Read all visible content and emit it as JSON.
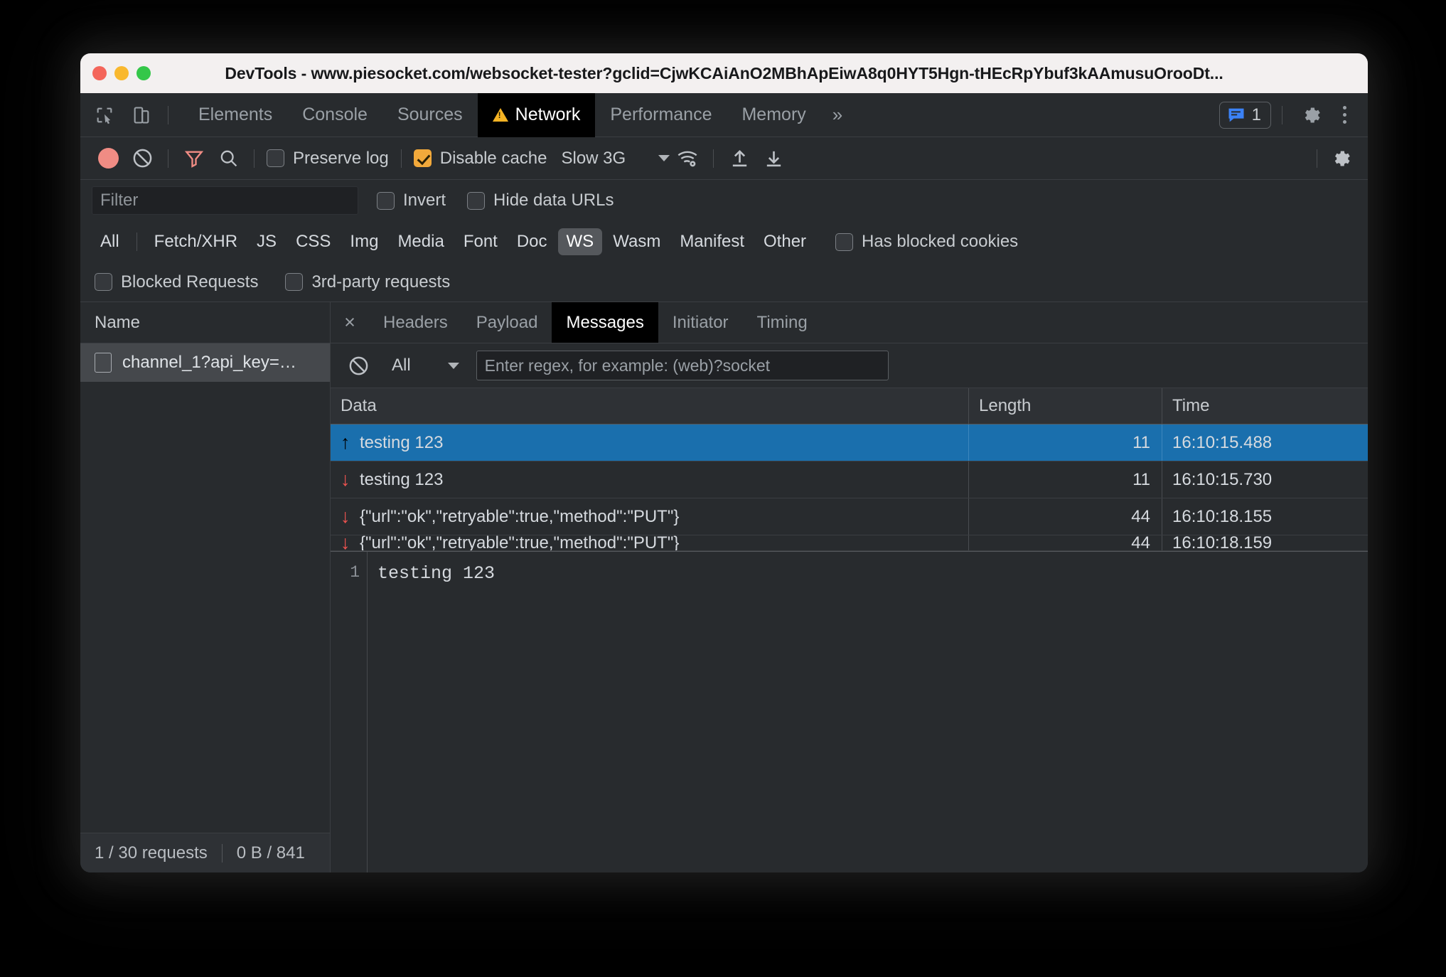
{
  "window": {
    "title": "DevTools - www.piesocket.com/websocket-tester?gclid=CjwKCAiAnO2MBhApEiwA8q0HYT5Hgn-tHEcRpYbuf3kAAmusuOrooDt...",
    "traffic_lights": [
      "close",
      "minimize",
      "maximize"
    ]
  },
  "devtools_tabs": {
    "icons": [
      "inspect-element-icon",
      "device-toolbar-icon"
    ],
    "items": [
      {
        "label": "Elements",
        "active": false
      },
      {
        "label": "Console",
        "active": false
      },
      {
        "label": "Sources",
        "active": false
      },
      {
        "label": "Network",
        "active": true,
        "warning": true
      },
      {
        "label": "Performance",
        "active": false
      },
      {
        "label": "Memory",
        "active": false
      }
    ],
    "overflow": "»",
    "message_badge_count": "1",
    "right_icons": [
      "settings-gear-icon",
      "more-options-icon"
    ]
  },
  "network_toolbar": {
    "record_label": "record-button",
    "clear_label": "clear-button",
    "filter_label": "filter-button",
    "search_label": "search-button",
    "preserve_log": {
      "label": "Preserve log",
      "checked": false
    },
    "disable_cache": {
      "label": "Disable cache",
      "checked": true
    },
    "throttling": {
      "value": "Slow 3G"
    },
    "network_conditions_icon": "wifi-settings-icon",
    "import_icon": "upload-har-icon",
    "export_icon": "download-har-icon",
    "settings_icon": "network-settings-gear-icon"
  },
  "filter_bar": {
    "placeholder": "Filter",
    "value": "",
    "invert": {
      "label": "Invert",
      "checked": false
    },
    "hide_data_urls": {
      "label": "Hide data URLs",
      "checked": false
    }
  },
  "type_filters": {
    "all": "All",
    "items": [
      "Fetch/XHR",
      "JS",
      "CSS",
      "Img",
      "Media",
      "Font",
      "Doc",
      "WS",
      "Wasm",
      "Manifest",
      "Other"
    ],
    "selected": "WS",
    "has_blocked_cookies": {
      "label": "Has blocked cookies",
      "checked": false
    },
    "blocked_requests": {
      "label": "Blocked Requests",
      "checked": false
    },
    "third_party_requests": {
      "label": "3rd-party requests",
      "checked": false
    }
  },
  "request_list": {
    "column_header": "Name",
    "rows": [
      {
        "name": "channel_1?api_key=…",
        "selected": true
      }
    ],
    "status": {
      "requests": "1 / 30 requests",
      "transferred": "0 B / 841"
    }
  },
  "detail_tabs": {
    "close": "×",
    "items": [
      {
        "label": "Headers",
        "active": false
      },
      {
        "label": "Payload",
        "active": false
      },
      {
        "label": "Messages",
        "active": true
      },
      {
        "label": "Initiator",
        "active": false
      },
      {
        "label": "Timing",
        "active": false
      }
    ]
  },
  "message_filter": {
    "clear_icon": "clear-messages-icon",
    "type_filter": "All",
    "regex_placeholder": "Enter regex, for example: (web)?socket",
    "regex_value": ""
  },
  "messages_table": {
    "columns": [
      "Data",
      "Length",
      "Time"
    ],
    "rows": [
      {
        "direction": "sent",
        "data": "testing 123",
        "length": "11",
        "time": "16:10:15.488",
        "selected": true
      },
      {
        "direction": "received",
        "data": "testing 123",
        "length": "11",
        "time": "16:10:15.730",
        "selected": false
      },
      {
        "direction": "received",
        "data": "{\"url\":\"ok\",\"retryable\":true,\"method\":\"PUT\"}",
        "length": "44",
        "time": "16:10:18.155",
        "selected": false
      },
      {
        "direction": "received",
        "data": "{\"url\":\"ok\",\"retryable\":true,\"method\":\"PUT\"}",
        "length": "44",
        "time": "16:10:18.159",
        "selected": false,
        "clipped": true
      }
    ]
  },
  "message_preview": {
    "line_number": "1",
    "content": "testing 123"
  },
  "colors": {
    "accent_selection": "#1a6fad",
    "record_red": "#f08c84",
    "checkbox_checked": "#f2a93b",
    "warning_yellow": "#f5b324",
    "badge_blue": "#3b82f6",
    "received_arrow": "#ef5350",
    "panel_bg": "#282b2e",
    "active_tab_bg": "#000000"
  }
}
